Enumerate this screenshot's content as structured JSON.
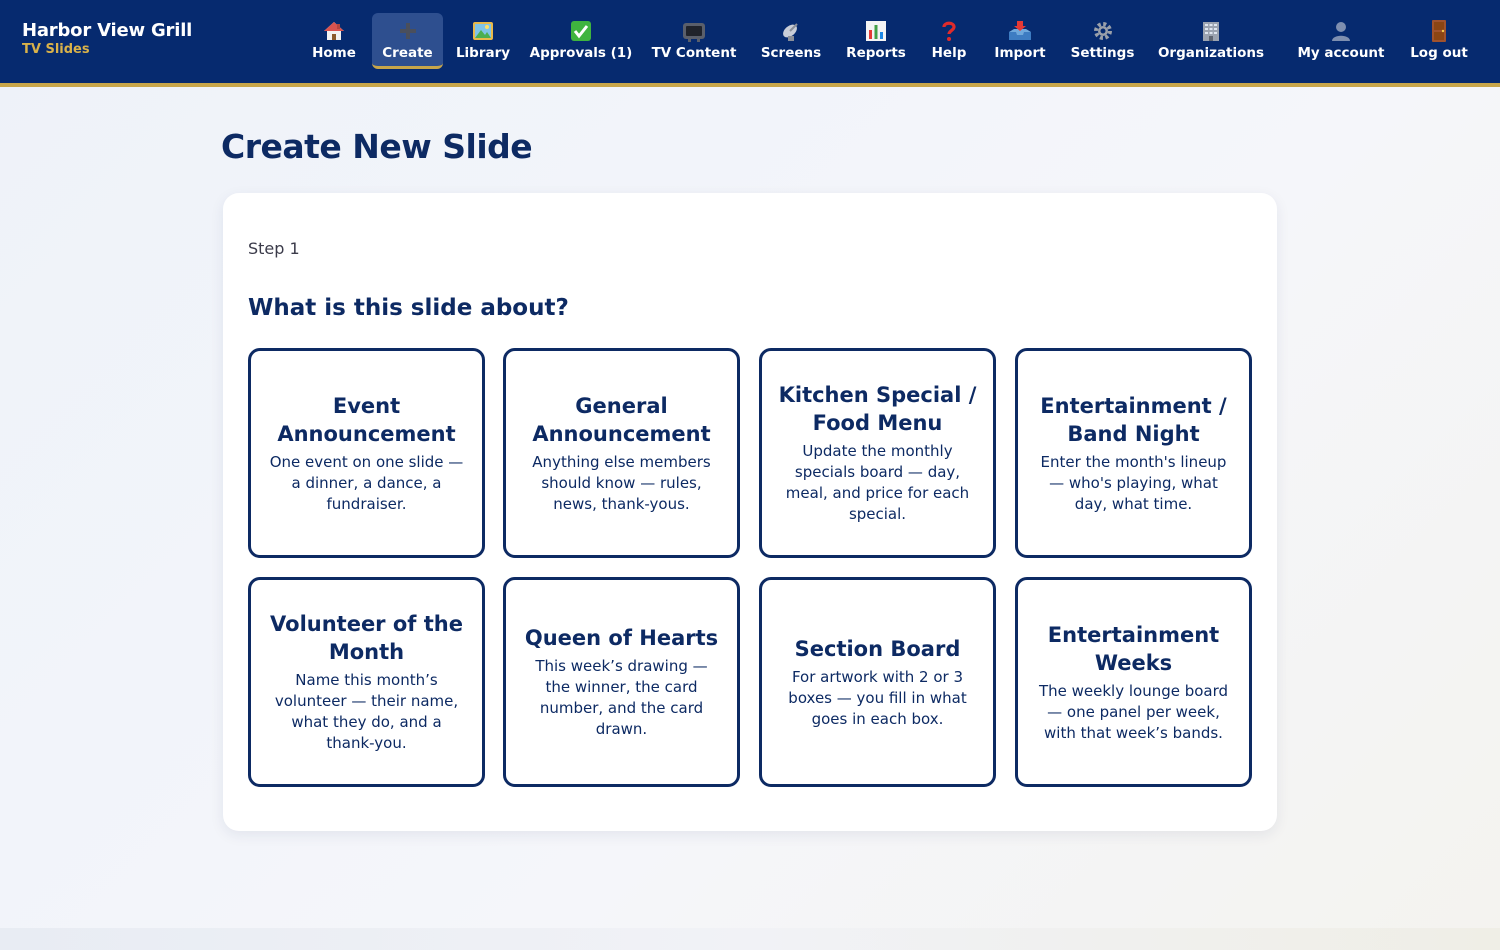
{
  "brand": {
    "title": "Harbor View Grill",
    "subtitle": "TV Slides"
  },
  "colors": {
    "navbar": "#062a6f",
    "accent": "#c8a64a",
    "text": "#0d2a63",
    "active_tab": "#2e4f8f"
  },
  "nav": {
    "home": {
      "label": "Home",
      "icon": "house-icon"
    },
    "create": {
      "label": "Create",
      "icon": "plus-icon"
    },
    "library": {
      "label": "Library",
      "icon": "picture-icon"
    },
    "approvals": {
      "label": "Approvals (1)",
      "icon": "checkmark-icon"
    },
    "tv_content": {
      "label": "TV Content",
      "icon": "television-icon"
    },
    "screens": {
      "label": "Screens",
      "icon": "satellite-dish-icon"
    },
    "reports": {
      "label": "Reports",
      "icon": "bar-chart-icon"
    },
    "help": {
      "label": "Help",
      "icon": "question-mark-icon"
    },
    "import": {
      "label": "Import",
      "icon": "inbox-tray-icon"
    },
    "settings": {
      "label": "Settings",
      "icon": "gear-icon"
    },
    "organizations": {
      "label": "Organizations",
      "icon": "office-building-icon"
    },
    "my_account": {
      "label": "My account",
      "icon": "user-silhouette-icon"
    },
    "log_out": {
      "label": "Log out",
      "icon": "door-icon"
    }
  },
  "page": {
    "title": "Create New Slide"
  },
  "wizard": {
    "step": "Step 1",
    "question": "What is this slide about?",
    "options": [
      {
        "title": "Event Announcement",
        "description": "One event on one slide — a dinner, a dance, a fundraiser."
      },
      {
        "title": "General Announcement",
        "description": "Anything else members should know — rules, news, thank-yous."
      },
      {
        "title": "Kitchen Special / Food Menu",
        "description": "Update the monthly specials board — day, meal, and price for each special."
      },
      {
        "title": "Entertainment / Band Night",
        "description": "Enter the month's lineup — who's playing, what day, what time."
      },
      {
        "title": "Volunteer of the Month",
        "description": "Name this month’s volunteer — their name, what they do, and a thank-you."
      },
      {
        "title": "Queen of Hearts",
        "description": "This week’s drawing — the winner, the card number, and the card drawn."
      },
      {
        "title": "Section Board",
        "description": "For artwork with 2 or 3 boxes — you fill in what goes in each box."
      },
      {
        "title": "Entertainment Weeks",
        "description": "The weekly lounge board — one panel per week, with that week’s bands."
      }
    ]
  }
}
